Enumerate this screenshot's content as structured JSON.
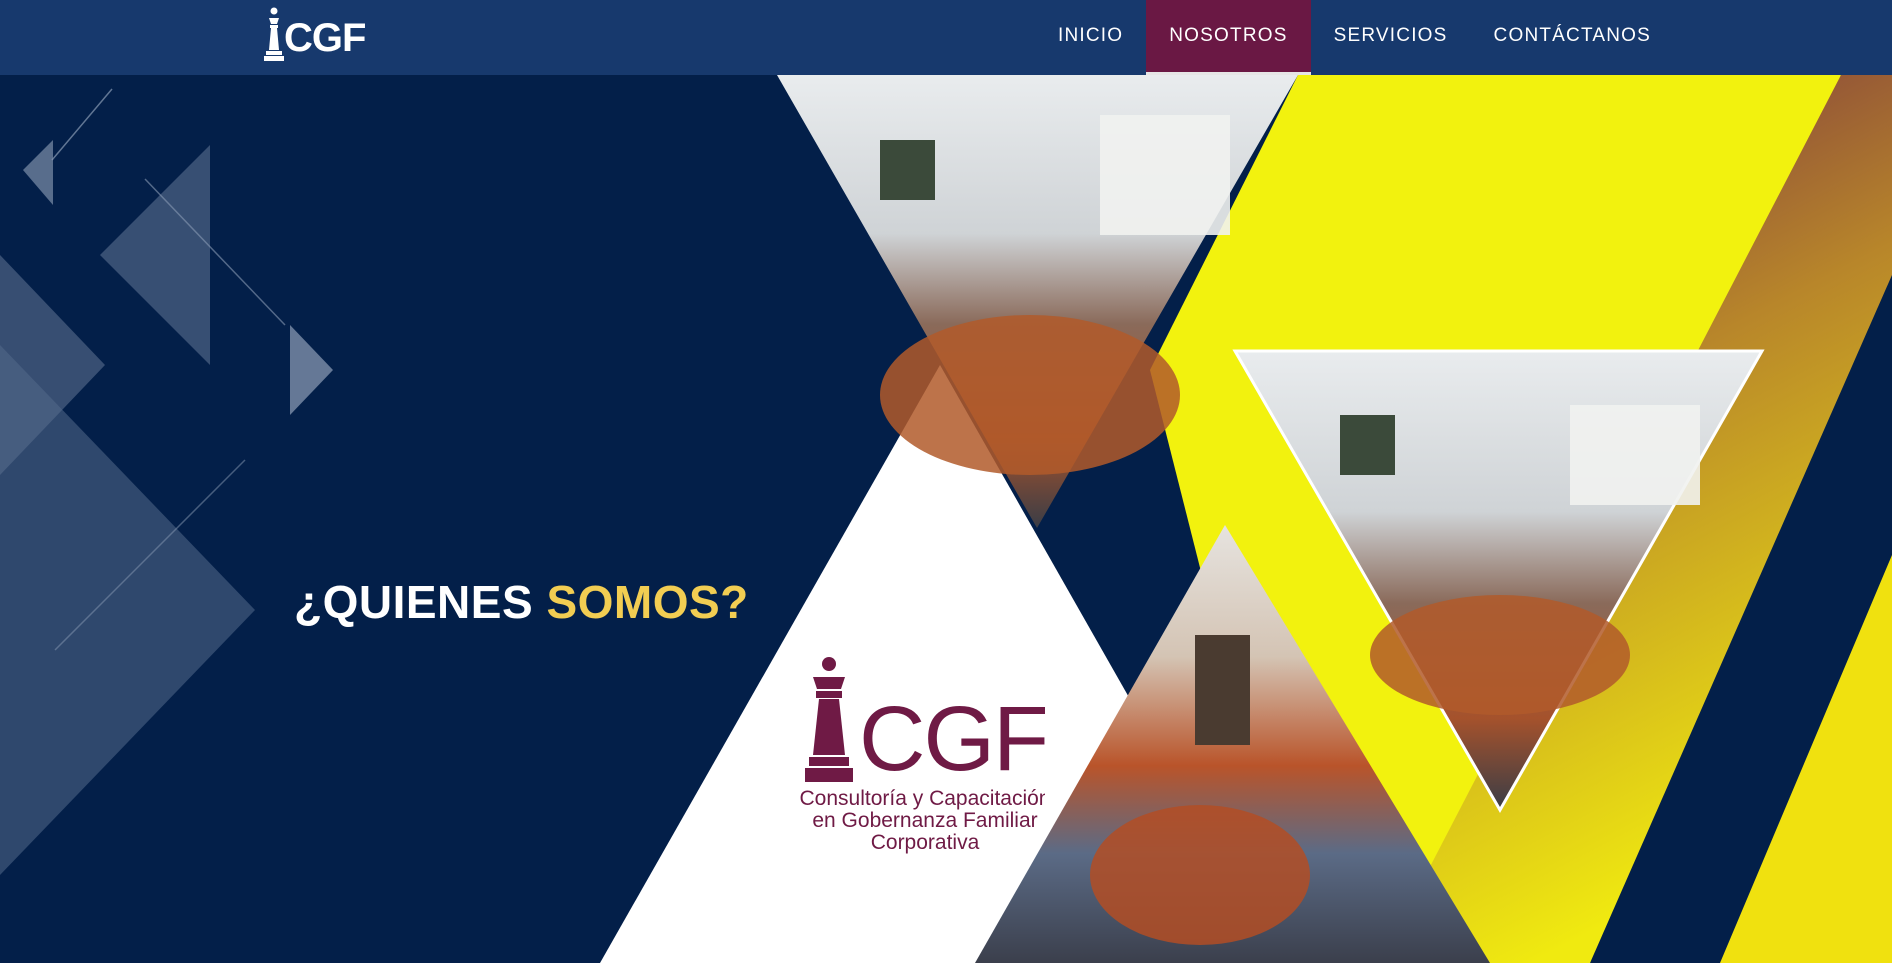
{
  "header": {
    "logo_text": "CGF",
    "nav": [
      {
        "label": "INICIO",
        "active": false
      },
      {
        "label": "NOSOTROS",
        "active": true
      },
      {
        "label": "SERVICIOS",
        "active": false
      },
      {
        "label": "CONTÁCTANOS",
        "active": false
      }
    ]
  },
  "hero": {
    "headline_part1": "¿QUIENES ",
    "headline_part2": "SOMOS?",
    "brand_logo_text": "CGF",
    "brand_tagline_line1": "Consultoría y Capacitación",
    "brand_tagline_line2": "en Gobernanza Familiar",
    "brand_tagline_line3": "Corporativa"
  },
  "colors": {
    "nav_bg": "#17396d",
    "nav_active": "#6a1844",
    "hero_bg": "#031f49",
    "accent_yellow": "#f2f20e",
    "headline_accent": "#f2cd52",
    "brand_maroon": "#6f1a45"
  },
  "icons": [
    "chess-queen-icon"
  ]
}
